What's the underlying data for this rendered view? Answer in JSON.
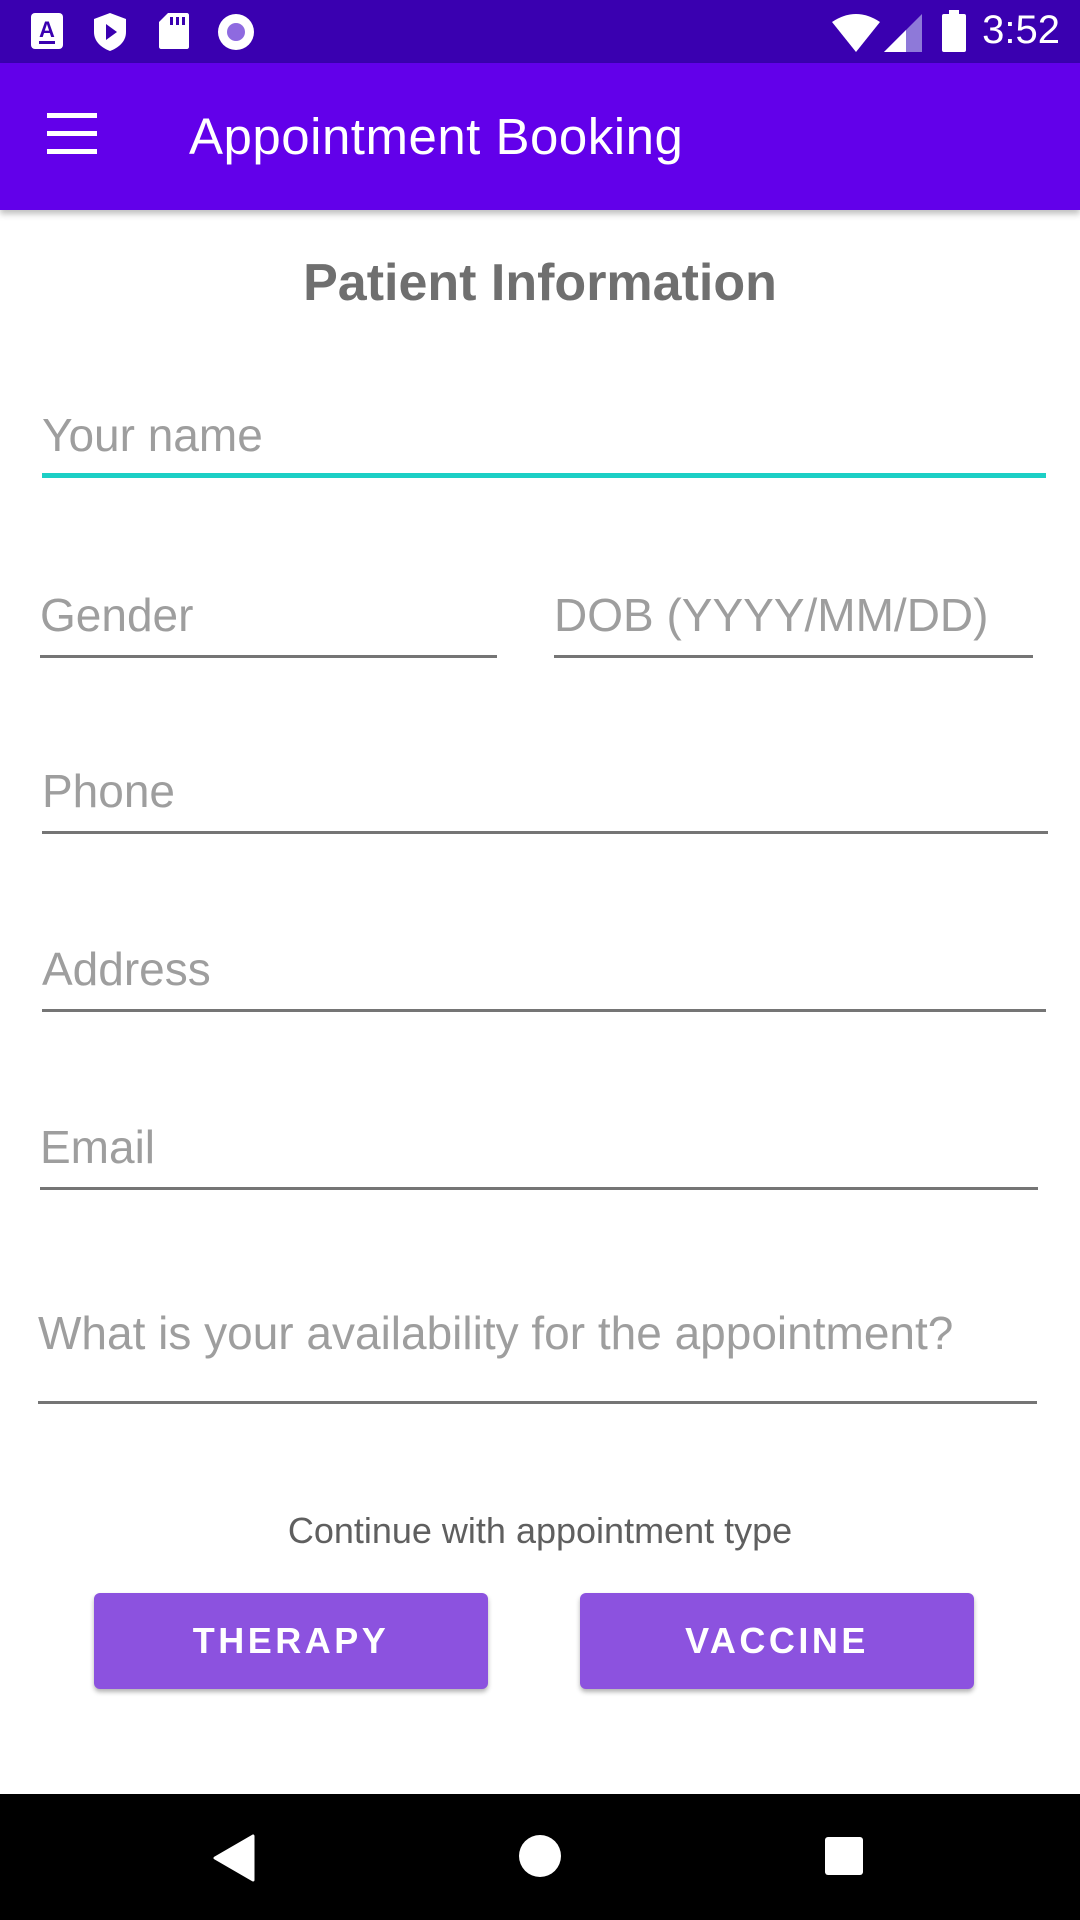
{
  "status_bar": {
    "time": "3:52",
    "icons": [
      "accessibility-icon",
      "play-protect-icon",
      "sd-card-icon",
      "record-icon",
      "wifi-icon",
      "signal-icon",
      "battery-icon"
    ]
  },
  "app_bar": {
    "title": "Appointment Booking",
    "menu_icon": "hamburger-menu-icon"
  },
  "form": {
    "title": "Patient Information",
    "name_placeholder": "Your name",
    "gender_placeholder": "Gender",
    "dob_placeholder": "DOB (YYYY/MM/DD)",
    "phone_placeholder": "Phone",
    "address_placeholder": "Address",
    "email_placeholder": "Email",
    "availability_placeholder": "What is your availability for the appointment?"
  },
  "appointment": {
    "prompt": "Continue with appointment type",
    "therapy_label": "THERAPY",
    "vaccine_label": "VACCINE"
  },
  "colors": {
    "status_bar": "#3a00b0",
    "app_bar": "#6200ea",
    "accent": "#1ccfc5",
    "button": "#8c52df"
  },
  "nav_bar": {
    "icons": [
      "back-icon",
      "home-icon",
      "recents-icon"
    ]
  }
}
